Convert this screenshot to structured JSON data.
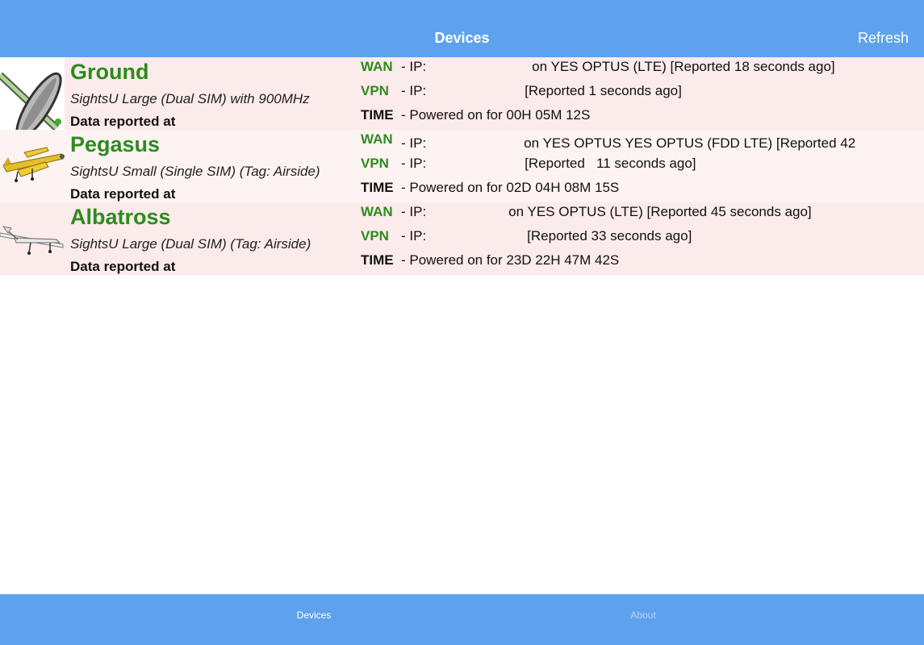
{
  "header": {
    "title": "Devices",
    "refresh_label": "Refresh"
  },
  "devices": [
    {
      "name": "Ground",
      "model": "SightsU Large (Dual SIM) with 900MHz",
      "reported_label": "Data reported at",
      "icon": "satellite-dish-icon",
      "wan_label": "WAN",
      "wan_text": "- IP:",
      "wan_detail": "on YES OPTUS (LTE) [Reported 18 seconds ago]",
      "vpn_label": "VPN",
      "vpn_text": "- IP:",
      "vpn_detail": "[Reported 1 seconds ago]",
      "time_label": "TIME",
      "time_text": "- Powered on for 00H 05M 12S"
    },
    {
      "name": "Pegasus",
      "model": "SightsU Small (Single SIM) (Tag: Airside)",
      "reported_label": "Data reported at",
      "icon": "yellow-drone-icon",
      "wan_label": "WAN",
      "wan_text": "- IP:",
      "wan_detail": "on YES OPTUS YES OPTUS (FDD LTE) [Reported 42",
      "vpn_label": "VPN",
      "vpn_text": "- IP:",
      "vpn_detail": "[Reported   11 seconds ago]",
      "time_label": "TIME",
      "time_text": "- Powered on for 02D 04H 08M 15S"
    },
    {
      "name": "Albatross",
      "model": "SightsU Large (Dual SIM) (Tag: Airside)",
      "reported_label": "Data reported at",
      "icon": "white-drone-icon",
      "wan_label": "WAN",
      "wan_text": "- IP:",
      "wan_detail": "on YES OPTUS (LTE) [Reported 45 seconds ago]",
      "vpn_label": "VPN",
      "vpn_text": "- IP:",
      "vpn_detail": "[Reported 33 seconds ago]",
      "time_label": "TIME",
      "time_text": "- Powered on for 23D 22H 47M 42S"
    }
  ],
  "tabs": {
    "devices_label": "Devices",
    "about_label": "About"
  },
  "colors": {
    "bar": "#5ea2ee",
    "accent_green": "#2e8b1f",
    "row_bg": "#fbebea"
  }
}
